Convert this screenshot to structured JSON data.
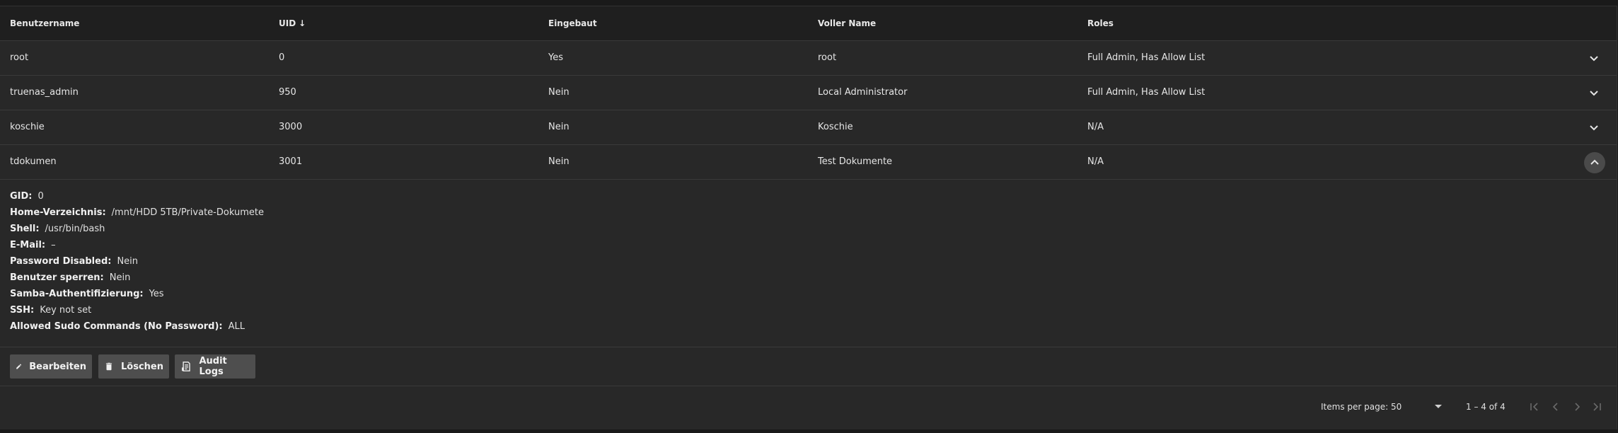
{
  "table": {
    "headers": {
      "username": "Benutzername",
      "uid": "UID",
      "builtin": "Eingebaut",
      "full_name": "Voller Name",
      "roles": "Roles"
    },
    "rows": [
      {
        "username": "root",
        "uid": "0",
        "builtin": "Yes",
        "full_name": "root",
        "roles": "Full Admin, Has Allow List"
      },
      {
        "username": "truenas_admin",
        "uid": "950",
        "builtin": "Nein",
        "full_name": "Local Administrator",
        "roles": "Full Admin, Has Allow List"
      },
      {
        "username": "koschie",
        "uid": "3000",
        "builtin": "Nein",
        "full_name": "Koschie",
        "roles": "N/A"
      },
      {
        "username": "tdokumen",
        "uid": "3001",
        "builtin": "Nein",
        "full_name": "Test Dokumente",
        "roles": "N/A"
      }
    ]
  },
  "details": [
    {
      "label": "GID:",
      "value": "0"
    },
    {
      "label": "Home-Verzeichnis:",
      "value": "/mnt/HDD 5TB/Private-Dokumete"
    },
    {
      "label": "Shell:",
      "value": "/usr/bin/bash"
    },
    {
      "label": "E-Mail:",
      "value": "–"
    },
    {
      "label": "Password Disabled:",
      "value": "Nein"
    },
    {
      "label": "Benutzer sperren:",
      "value": "Nein"
    },
    {
      "label": "Samba-Authentifizierung:",
      "value": "Yes"
    },
    {
      "label": "SSH:",
      "value": "Key not set"
    },
    {
      "label": "Allowed Sudo Commands (No Password):",
      "value": "ALL"
    }
  ],
  "actions": {
    "edit": "Bearbeiten",
    "delete": "Löschen",
    "audit": "Audit Logs"
  },
  "paginator": {
    "items_per_page_label": "Items per page:",
    "items_per_page_value": "50",
    "range_label": "1 – 4 of 4"
  },
  "icons": {
    "sort": "arrow-down-icon",
    "expand": "chevron-down-icon",
    "collapse": "chevron-up-icon",
    "edit": "pencil-icon",
    "delete": "trash-icon",
    "audit": "receipt-icon"
  }
}
